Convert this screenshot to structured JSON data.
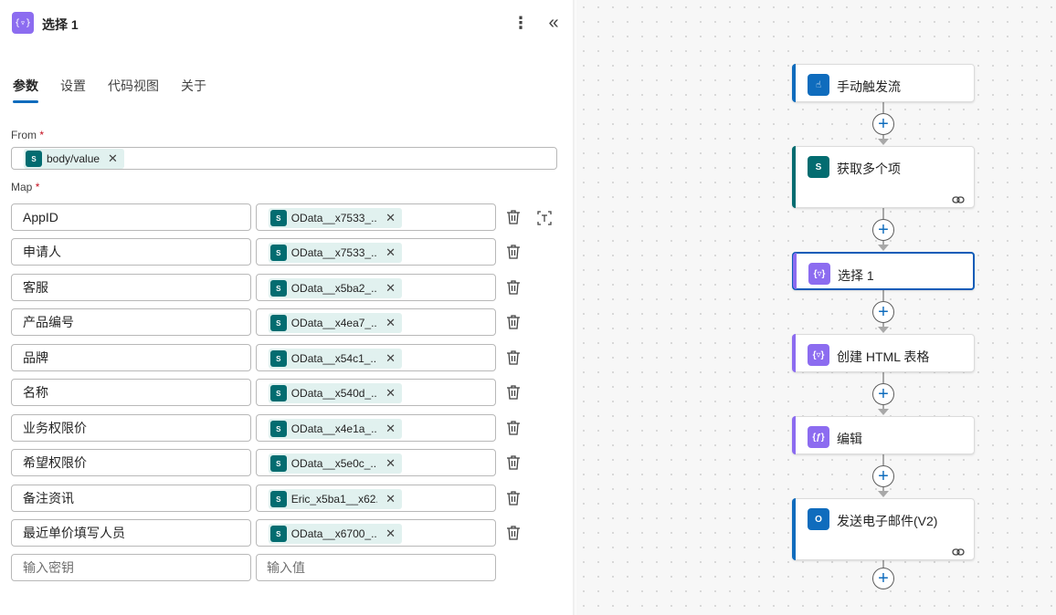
{
  "panel": {
    "title": "选择 1",
    "more_label": "⋮",
    "collapse_label": "«",
    "header_icon_glyph": "{▿}",
    "tabs": [
      {
        "label": "参数",
        "active": true
      },
      {
        "label": "设置",
        "active": false
      },
      {
        "label": "代码视图",
        "active": false
      },
      {
        "label": "关于",
        "active": false
      }
    ],
    "from": {
      "label": "From",
      "required_mark": "*",
      "token": "body/value",
      "token_icon": "sharepoint-icon"
    },
    "map": {
      "label": "Map",
      "required_mark": "*",
      "rows": [
        {
          "key": "AppID",
          "value": "OData__x7533_..."
        },
        {
          "key": "申请人",
          "value": "OData__x7533_..."
        },
        {
          "key": "客服",
          "value": "OData__x5ba2_..."
        },
        {
          "key": "产品编号",
          "value": "OData__x4ea7_..."
        },
        {
          "key": "品牌",
          "value": "OData__x54c1_..."
        },
        {
          "key": "名称",
          "value": "OData__x540d_..."
        },
        {
          "key": "业务权限价",
          "value": "OData__x4e1a_..."
        },
        {
          "key": "希望权限价",
          "value": "OData__x5e0c_..."
        },
        {
          "key": "备注资讯",
          "value": "Eric_x5ba1__x62..."
        },
        {
          "key": "最近单价填写人员",
          "value": "OData__x6700_..."
        }
      ],
      "key_placeholder": "输入密钥",
      "value_placeholder": "输入值"
    },
    "token_remove_glyph": "✕",
    "sp_glyph": "S"
  },
  "canvas": {
    "add_glyph": "+",
    "nodes": [
      {
        "label": "手动触发流",
        "icon": "manual-trigger-icon",
        "color": "#0f6cbd",
        "glyph": "☝"
      },
      {
        "label": "获取多个项",
        "icon": "sharepoint-icon",
        "color": "#036c70",
        "glyph": "S"
      },
      {
        "label": "选择 1",
        "icon": "data-operation-icon",
        "color": "#8c6cf0",
        "glyph": "{▿}"
      },
      {
        "label": "创建 HTML 表格",
        "icon": "data-operation-icon",
        "color": "#8c6cf0",
        "glyph": "{▿}"
      },
      {
        "label": "编辑",
        "icon": "data-operation-icon",
        "color": "#8c6cf0",
        "glyph": "{ƒ}"
      },
      {
        "label": "发送电子邮件(V2)",
        "icon": "outlook-icon",
        "color": "#0f6cbd",
        "glyph": "O"
      }
    ]
  }
}
